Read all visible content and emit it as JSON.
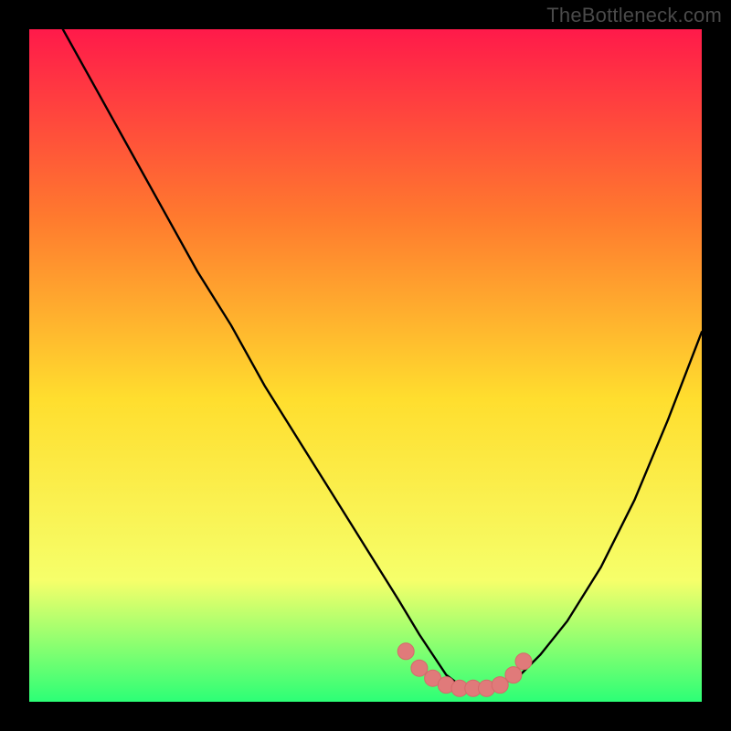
{
  "watermark": "TheBottleneck.com",
  "colors": {
    "frame": "#000000",
    "gradient_top": "#ff1a4a",
    "gradient_mid_upper": "#ff7a2e",
    "gradient_mid": "#ffde2e",
    "gradient_lower": "#f6ff6a",
    "gradient_bottom": "#2cff76",
    "curve": "#000000",
    "marker_fill": "#e07a7a",
    "marker_stroke": "#d46a6a"
  },
  "chart_data": {
    "type": "line",
    "title": "",
    "xlabel": "",
    "ylabel": "",
    "xlim": [
      0,
      100
    ],
    "ylim": [
      0,
      100
    ],
    "series": [
      {
        "name": "bottleneck-curve",
        "x": [
          5,
          10,
          15,
          20,
          25,
          30,
          35,
          40,
          45,
          50,
          55,
          58,
          60,
          62,
          64,
          66,
          68,
          70,
          73,
          76,
          80,
          85,
          90,
          95,
          100
        ],
        "y": [
          100,
          91,
          82,
          73,
          64,
          56,
          47,
          39,
          31,
          23,
          15,
          10,
          7,
          4,
          2.5,
          2,
          2,
          2.5,
          4,
          7,
          12,
          20,
          30,
          42,
          55
        ]
      }
    ],
    "markers": {
      "name": "highlight-valley",
      "x": [
        56,
        58,
        60,
        62,
        64,
        66,
        68,
        70,
        72,
        73.5
      ],
      "y": [
        7.5,
        5,
        3.5,
        2.5,
        2,
        2,
        2,
        2.5,
        4,
        6
      ]
    }
  }
}
